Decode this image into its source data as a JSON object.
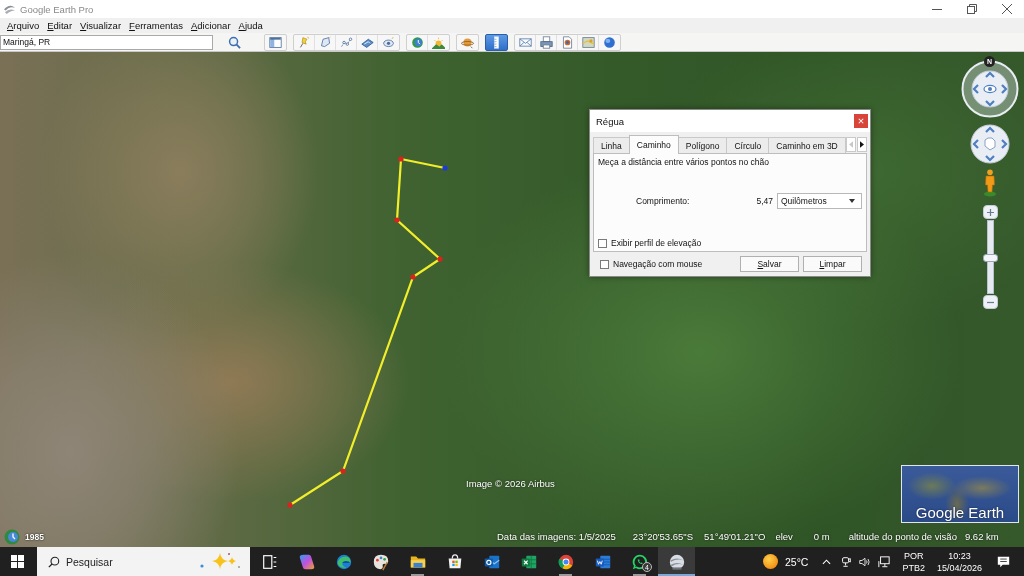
{
  "window": {
    "title": "Google Earth Pro"
  },
  "menu": [
    {
      "label": "Arquivo"
    },
    {
      "label": "Editar"
    },
    {
      "label": "Visualizar"
    },
    {
      "label": "Ferramentas"
    },
    {
      "label": "Adicionar"
    },
    {
      "label": "Ajuda"
    }
  ],
  "toolbar": {
    "search": {
      "value": "Maringá, PR"
    },
    "groups": [
      [
        {
          "kind": "sidebar",
          "selected": false
        }
      ],
      [
        {
          "kind": "placemark",
          "selected": false
        },
        {
          "kind": "polygon",
          "selected": false
        },
        {
          "kind": "path",
          "selected": false
        },
        {
          "kind": "overlay",
          "selected": false
        },
        {
          "kind": "tour",
          "selected": false
        }
      ],
      [
        {
          "kind": "history",
          "selected": false
        },
        {
          "kind": "sunlight",
          "selected": false
        }
      ],
      [
        {
          "kind": "planets",
          "selected": false
        }
      ],
      [
        {
          "kind": "ruler",
          "selected": true
        }
      ],
      [
        {
          "kind": "email",
          "selected": false
        },
        {
          "kind": "print",
          "selected": false
        },
        {
          "kind": "save-image",
          "selected": false
        },
        {
          "kind": "maps",
          "selected": false
        },
        {
          "kind": "web",
          "selected": false
        }
      ]
    ]
  },
  "map": {
    "attribution": "Image © 2026 Airbus",
    "historical_imagery": {
      "year": "1985"
    },
    "status_bar": {
      "imagery_date": "Data das imagens: 1/5/2025",
      "latitude": "23°20'53.65\"S",
      "longitude": "51°49'01.21\"O",
      "elevation_label": "elev",
      "elevation_value": "0 m",
      "eye_altitude_label": "altitude do ponto de visão",
      "eye_altitude_value": "9.62 km"
    },
    "navigation": {
      "north": "N",
      "zoom": {
        "level": 0.5
      }
    },
    "overview_map": {
      "logo": "Google Earth"
    }
  },
  "ruler_dialog": {
    "title": "Régua",
    "tabs": [
      {
        "label": "Linha",
        "selected": false
      },
      {
        "label": "Caminho",
        "selected": true
      },
      {
        "label": "Polígono",
        "selected": false
      },
      {
        "label": "Círculo",
        "selected": false
      },
      {
        "label": "Caminho em 3D",
        "selected": false
      }
    ],
    "tab_scroll": [
      {
        "kind": "left",
        "disabled": true
      },
      {
        "kind": "right",
        "disabled": false
      }
    ],
    "description": "Meça a distância entre vários pontos no chão",
    "length": {
      "label": "Comprimento:",
      "value": "5,47",
      "unit": "Quilômetros"
    },
    "elevation_profile": {
      "label": "Exibir perfil de elevação",
      "checked": false
    },
    "mouse_navigation": {
      "label": "Navegação com mouse",
      "checked": false
    },
    "buttons": [
      {
        "label": "Salvar"
      },
      {
        "label": "Limpar"
      }
    ]
  },
  "taskbar": {
    "search": {
      "placeholder": "Pesquisar"
    },
    "apps": [
      {
        "kind": "task-view",
        "running": false,
        "selected": false
      },
      {
        "kind": "copilot",
        "running": false,
        "selected": false
      },
      {
        "kind": "edge",
        "running": false,
        "selected": false
      },
      {
        "kind": "paint",
        "running": false,
        "selected": false
      },
      {
        "kind": "explorer",
        "running": true,
        "selected": false
      },
      {
        "kind": "store",
        "running": false,
        "selected": false
      },
      {
        "kind": "outlook",
        "running": false,
        "selected": false
      },
      {
        "kind": "excel",
        "running": false,
        "selected": false
      },
      {
        "kind": "chrome",
        "running": true,
        "selected": false
      },
      {
        "kind": "word",
        "running": false,
        "selected": false
      },
      {
        "kind": "whatsapp",
        "running": true,
        "selected": false,
        "badge": "4"
      },
      {
        "kind": "earth",
        "running": true,
        "selected": true
      }
    ],
    "weather": {
      "temperature": "25°C"
    },
    "input_language": {
      "line_1": "POR",
      "line_2": "PTB2"
    },
    "clock": {
      "time": "10:23",
      "date": "15/04/2026"
    }
  }
}
